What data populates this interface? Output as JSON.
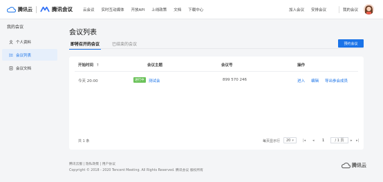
{
  "header": {
    "brand_tencent_cloud": "腾讯云",
    "brand_meeting": "腾讯会议",
    "nav": [
      "云会议",
      "实时互动媒体",
      "开放API",
      "上线政策",
      "文档",
      "下载中心"
    ],
    "join": "加入会议",
    "schedule": "安排会议",
    "my_meetings": "我的会议"
  },
  "sidebar": {
    "title": "我的会议",
    "items": [
      {
        "label": "个人资料",
        "icon": "user-icon"
      },
      {
        "label": "会议列表",
        "icon": "list-icon"
      },
      {
        "label": "会议文档",
        "icon": "doc-icon"
      }
    ]
  },
  "main": {
    "title": "会议列表",
    "tabs": [
      "即将召开的会议",
      "已结束的会议"
    ],
    "create_button": "预约会议"
  },
  "table": {
    "headers": [
      "开始时间",
      "会议主题",
      "会议号",
      "操作"
    ],
    "sort_indicator": "↑",
    "rows": [
      {
        "time": "今天 20:00",
        "badge": "进行中",
        "topic": "测试会",
        "meeting_id": "899 570 246",
        "actions": [
          "进入",
          "编辑",
          "导出参会成员"
        ]
      }
    ],
    "total": "共 1 条",
    "per_page_label": "每页显示行",
    "per_page_value": "20",
    "page_current": "1",
    "page_total": "/ 1 页"
  },
  "footer": {
    "links": "腾讯云服 | 隐私政策 | 用户协议",
    "copyright": "Copyright © 2018 - 2020 Tencent Meeting. All Rights Reserved. 腾讯会议 版权所有",
    "logo": "腾讯云"
  },
  "colors": {
    "accent": "#1a73e8",
    "badge": "#6ac259"
  }
}
